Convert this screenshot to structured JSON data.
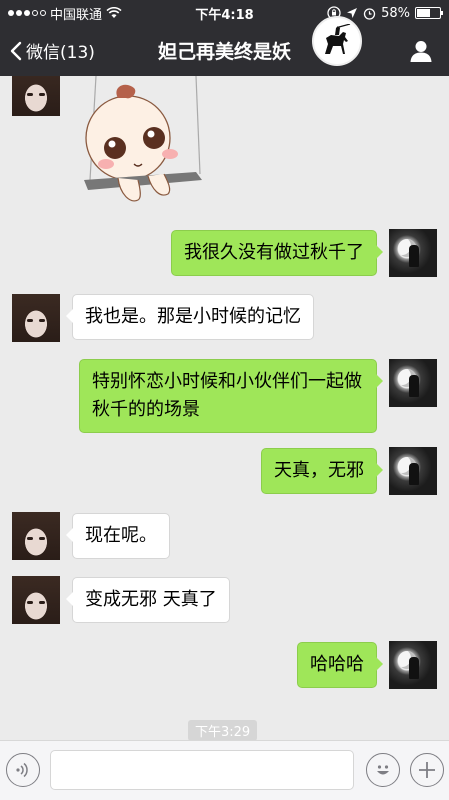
{
  "status_bar": {
    "carrier": "中国联通",
    "time": "下午4:18",
    "battery": "58%",
    "battery_level": 0.58
  },
  "nav": {
    "back_label": "微信(13)",
    "title": "妲己再美终是妖"
  },
  "messages": [
    {
      "side": "left",
      "kind": "sticker",
      "sticker_name": "baby-on-swing"
    },
    {
      "side": "right",
      "kind": "text",
      "text": "我很久没有做过秋千了"
    },
    {
      "side": "left",
      "kind": "text",
      "text": "我也是。那是小时候的记忆"
    },
    {
      "side": "right",
      "kind": "text",
      "text": "特别怀恋小时候和小伙伴们一起做秋千的的场景"
    },
    {
      "side": "right",
      "kind": "text",
      "text": "天真，无邪"
    },
    {
      "side": "left",
      "kind": "text",
      "text": "现在呢。"
    },
    {
      "side": "left",
      "kind": "text",
      "text": "变成无邪 天真了"
    },
    {
      "side": "right",
      "kind": "text",
      "text": "哈哈哈"
    }
  ],
  "timestamp": "下午3:29",
  "input": {
    "value": "",
    "placeholder": ""
  },
  "icons": {
    "voice": "voice-icon",
    "emoji": "emoji-icon",
    "more": "plus-icon",
    "profile": "person-icon"
  },
  "colors": {
    "bar_bg": "#2e2e32",
    "chat_bg": "#ebebeb",
    "bubble_mine": "#9fe659",
    "bubble_theirs": "#ffffff"
  }
}
